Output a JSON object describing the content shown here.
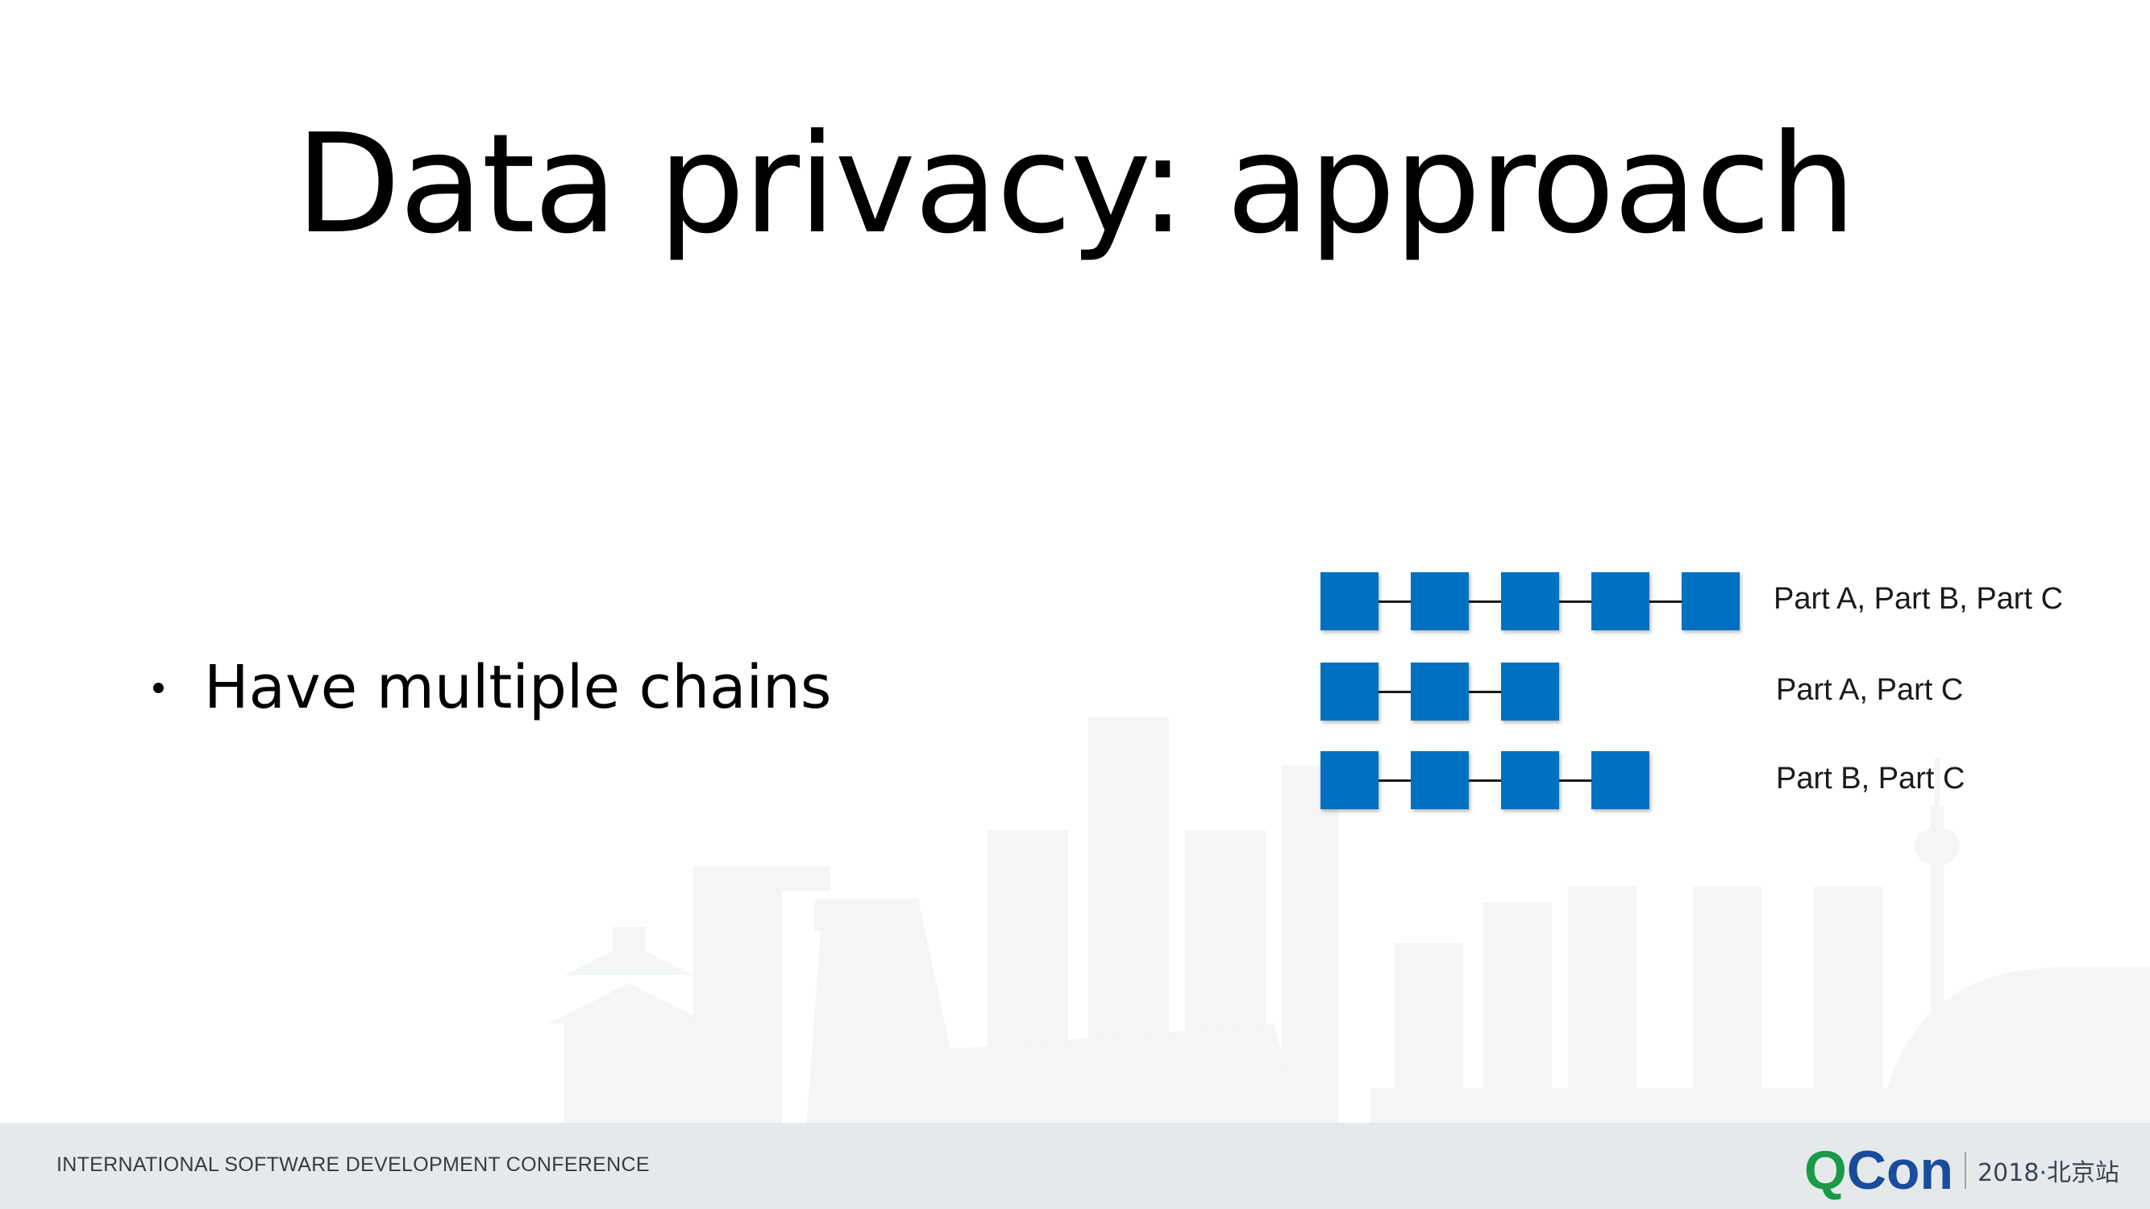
{
  "slide": {
    "title": "Data privacy: approach",
    "bullets": [
      "Have multiple chains"
    ]
  },
  "chains": [
    {
      "blocks": 5,
      "label": "Part A, Part B, Part C"
    },
    {
      "blocks": 3,
      "label": "Part A, Part C"
    },
    {
      "blocks": 4,
      "label": "Part B, Part C"
    }
  ],
  "footer": {
    "conference": "INTERNATIONAL SOFTWARE DEVELOPMENT CONFERENCE",
    "logo_q": "Q",
    "logo_con": "Con",
    "logo_edition": "2018·北京站"
  },
  "colors": {
    "block": "#0070c0",
    "footer_bg": "#e6e9ec",
    "logo_green": "#1a9a48",
    "logo_blue": "#1a4c9c"
  }
}
